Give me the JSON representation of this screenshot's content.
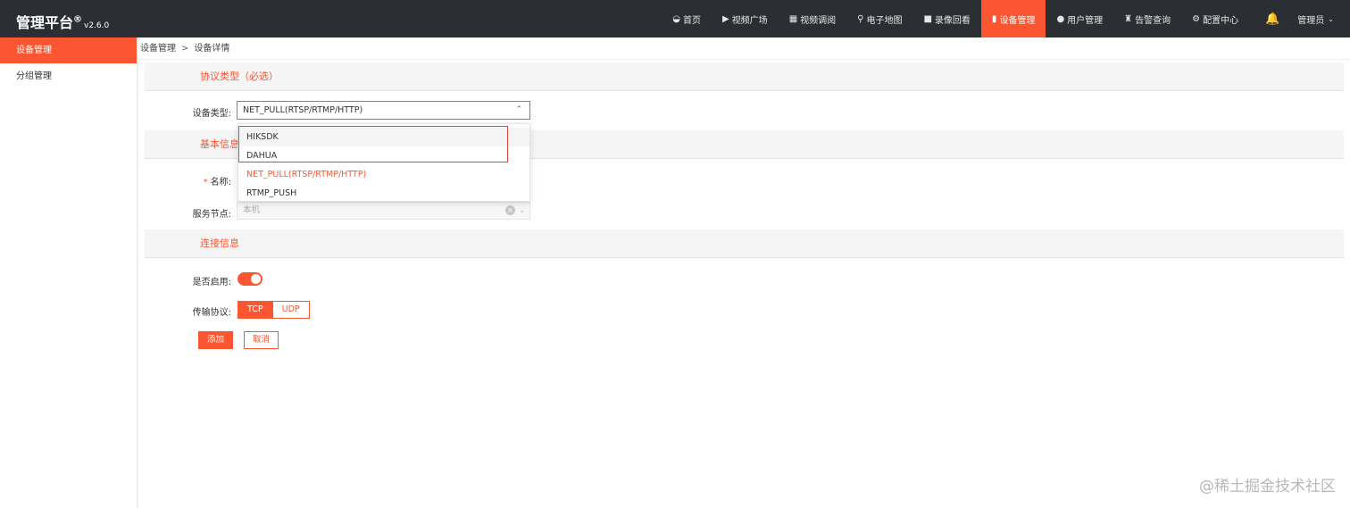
{
  "header": {
    "brand": "管理平台",
    "brand_mark": "®",
    "version": "v2.6.0",
    "nav": [
      {
        "icon": "dashboard-icon",
        "glyph": "◒",
        "label": "首页"
      },
      {
        "icon": "play-circle-icon",
        "glyph": "▶",
        "label": "视频广场"
      },
      {
        "icon": "grid-layout-icon",
        "glyph": "▦",
        "label": "视频调阅"
      },
      {
        "icon": "map-pin-icon",
        "glyph": "⚲",
        "label": "电子地图"
      },
      {
        "icon": "video-camera-icon",
        "glyph": "■",
        "label": "录像回看"
      },
      {
        "icon": "device-icon",
        "glyph": "▮",
        "label": "设备管理"
      },
      {
        "icon": "user-icon",
        "glyph": "●",
        "label": "用户管理"
      },
      {
        "icon": "alarm-icon",
        "glyph": "♜",
        "label": "告警查询"
      },
      {
        "icon": "gear-icon",
        "glyph": "⚙",
        "label": "配置中心"
      }
    ],
    "active_nav": "设备管理",
    "bell_glyph": "🔔",
    "user": "管理员",
    "user_chevron": "⌄"
  },
  "sidebar": {
    "items": [
      {
        "label": "设备管理"
      },
      {
        "label": "分组管理"
      }
    ]
  },
  "breadcrumb": {
    "items": [
      "设备管理",
      "设备详情"
    ],
    "separator": ">"
  },
  "sections": {
    "protocol": "协议类型（必选）",
    "basic": "基本信息",
    "connection": "连接信息"
  },
  "form": {
    "device_type_label": "设备类型:",
    "device_type_value": "NET_PULL(RTSP/RTMP/HTTP)",
    "device_type_options": [
      "HIKSDK",
      "DAHUA",
      "NET_PULL(RTSP/RTMP/HTTP)",
      "RTMP_PUSH"
    ],
    "name_required_mark": "*",
    "name_label": "名称:",
    "service_node_label": "服务节点:",
    "service_node_value": "本机",
    "enabled_label": "是否启用:",
    "enabled": true,
    "transport_label": "传输协议:",
    "transport_options": [
      "TCP",
      "UDP"
    ],
    "transport_selected": "TCP",
    "add_button": "添加",
    "cancel_button": "取消"
  },
  "watermark": "@稀土掘金技术社区",
  "colors": {
    "accent": "#fc5531",
    "topbar": "#2b2e33",
    "highlight": "#e2473b"
  }
}
